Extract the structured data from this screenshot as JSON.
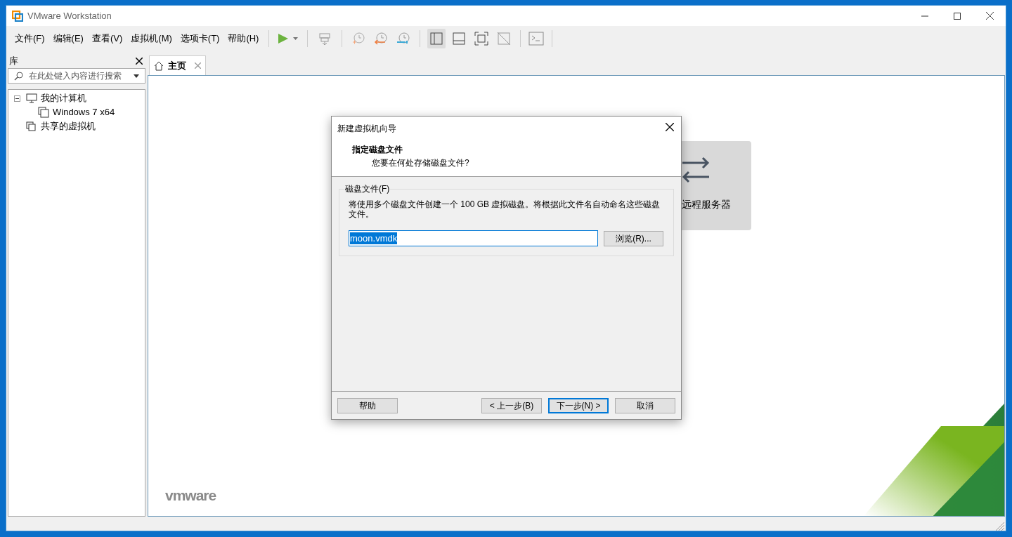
{
  "window": {
    "title": "VMware Workstation"
  },
  "menu": [
    "文件(F)",
    "编辑(E)",
    "查看(V)",
    "虚拟机(M)",
    "选项卡(T)",
    "帮助(H)"
  ],
  "library": {
    "title": "库",
    "search_placeholder": "在此处键入内容进行搜索",
    "tree": [
      {
        "label": "我的计算机",
        "expanded": true,
        "children": [
          {
            "label": "Windows 7 x64"
          }
        ]
      },
      {
        "label": "共享的虚拟机"
      }
    ]
  },
  "tabs": [
    {
      "label": "主页",
      "selected": true
    }
  ],
  "home": {
    "card_label": "远程服务器",
    "brand": "vmware"
  },
  "dialog": {
    "title": "新建虚拟机向导",
    "heading": "指定磁盘文件",
    "subheading": "您要在何处存储磁盘文件?",
    "group_label": "磁盘文件(F)",
    "description": "将使用多个磁盘文件创建一个 100 GB 虚拟磁盘。将根据此文件名自动命名这些磁盘文件。",
    "file_value": "moon.vmdk",
    "browse_button": "浏览(R)...",
    "buttons": [
      {
        "label": "帮助",
        "default": false
      },
      {
        "label": "< 上一步(B)",
        "default": false
      },
      {
        "label": "下一步(N) >",
        "default": true
      },
      {
        "label": "取消",
        "default": false
      }
    ]
  }
}
